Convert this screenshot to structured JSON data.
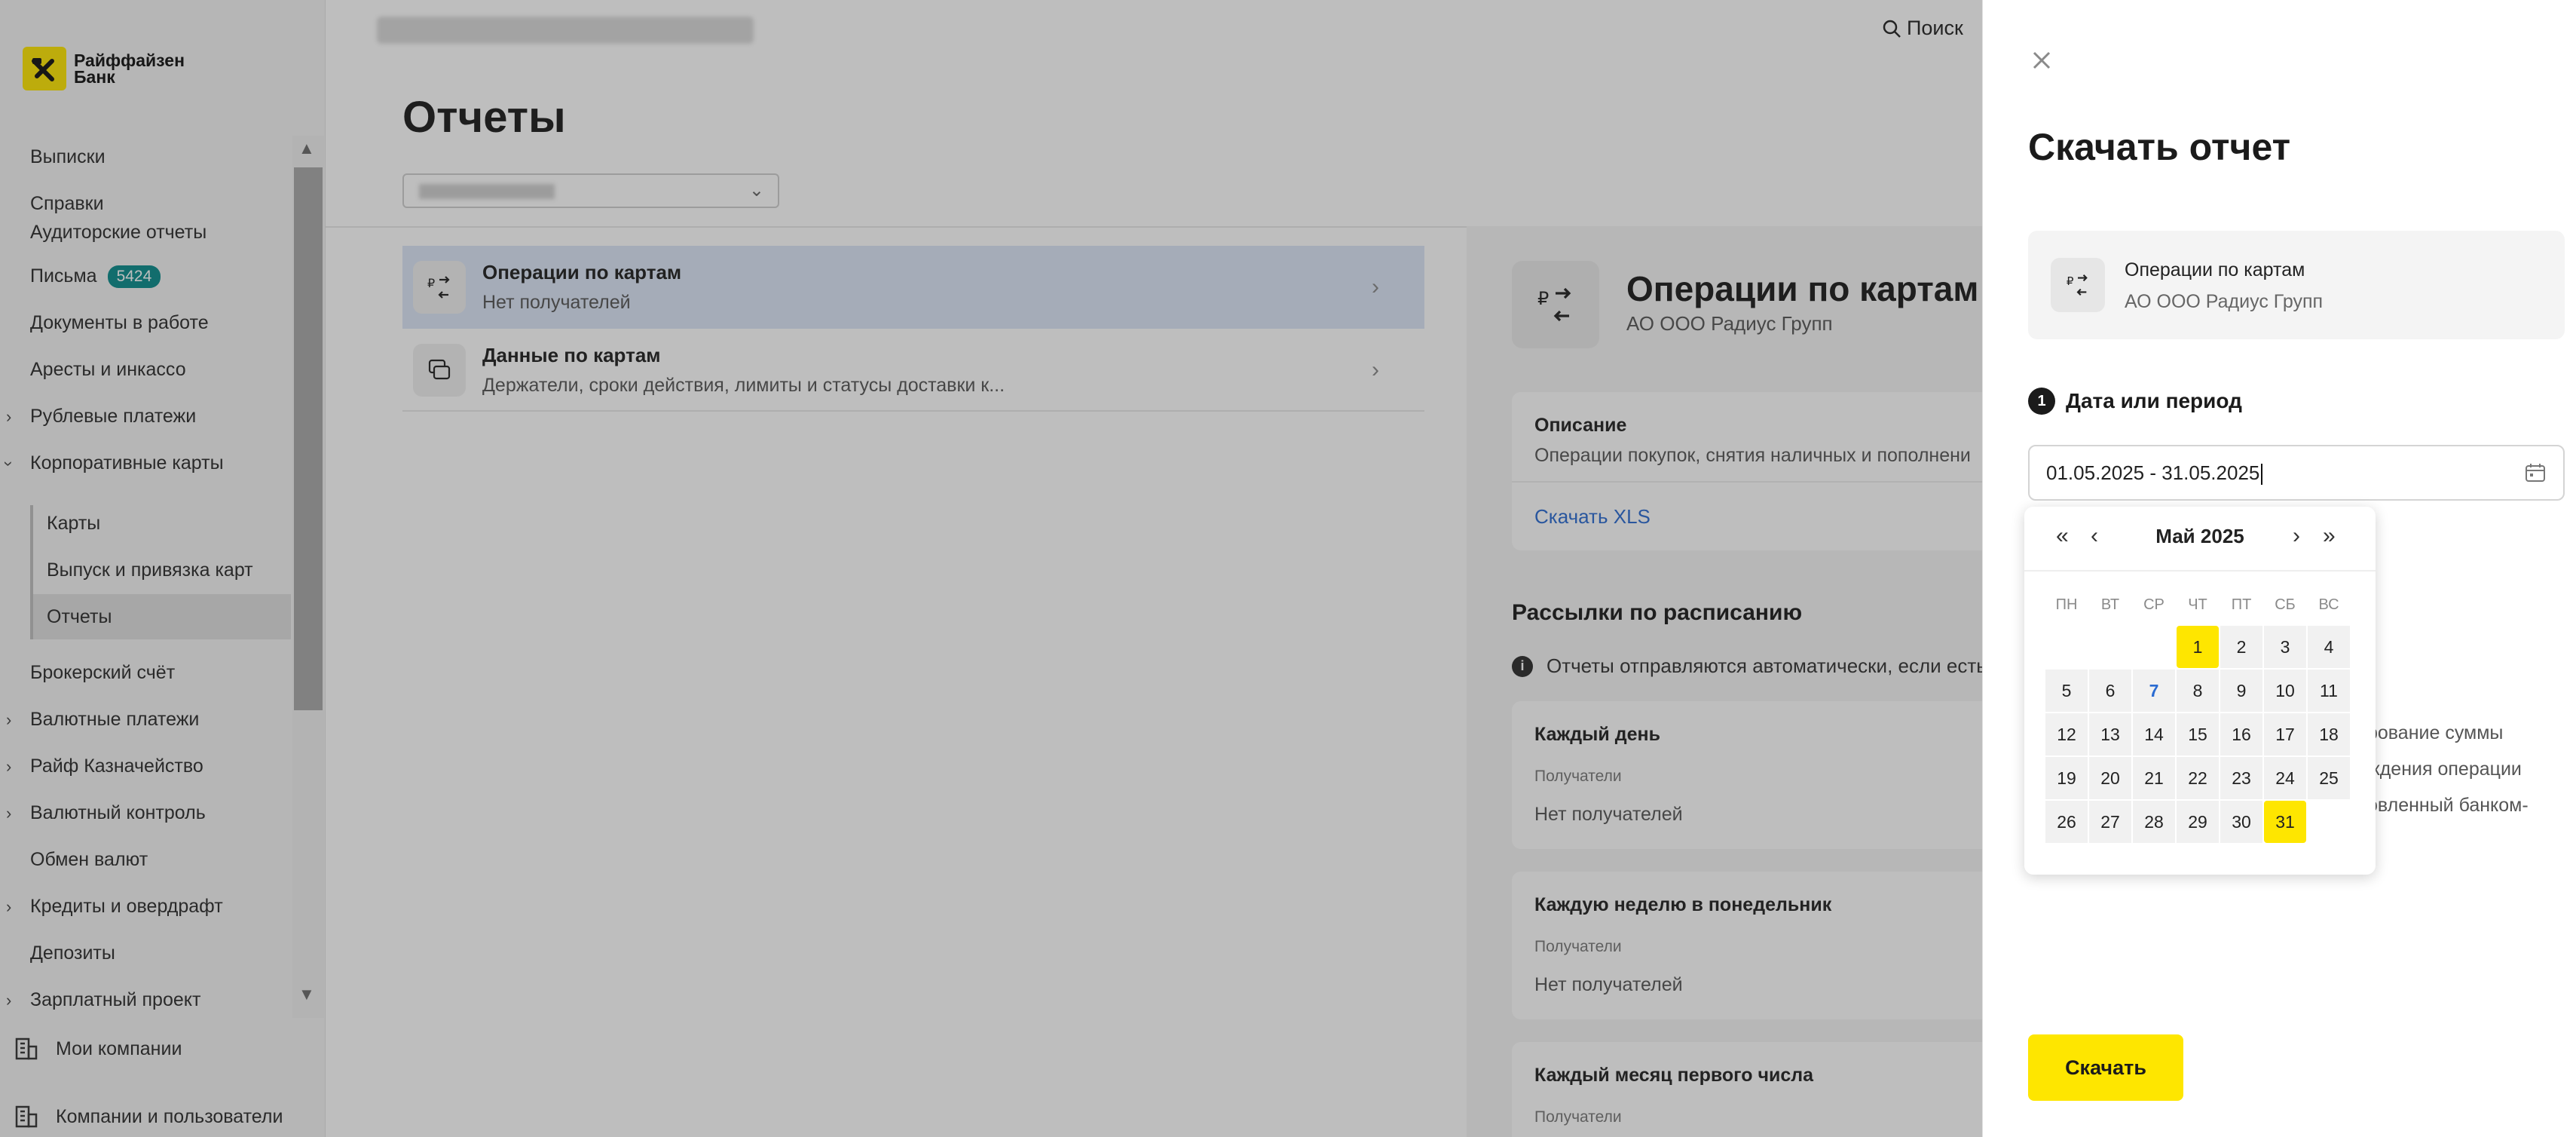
{
  "brand": {
    "name_line1": "Райффайзен",
    "name_line2": "Банк",
    "accent": "#fee600"
  },
  "sidebar": {
    "items": [
      {
        "label": "Выписки"
      },
      {
        "label": "Справки"
      },
      {
        "label": "Аудиторские отчеты"
      },
      {
        "label": "Письма",
        "badge": "5424"
      },
      {
        "label": "Документы в работе"
      },
      {
        "label": "Аресты и инкассо"
      },
      {
        "label": "Рублевые платежи",
        "expandable": true
      },
      {
        "label": "Корпоративные карты",
        "expanded": true
      },
      {
        "label": "Карты",
        "sub": true
      },
      {
        "label": "Выпуск и привязка карт",
        "sub": true
      },
      {
        "label": "Отчеты",
        "sub": true,
        "active": true
      },
      {
        "label": "Брокерский счёт"
      },
      {
        "label": "Валютные платежи",
        "expandable": true
      },
      {
        "label": "Райф Казначейство",
        "expandable": true
      },
      {
        "label": "Валютный контроль",
        "expandable": true
      },
      {
        "label": "Обмен валют"
      },
      {
        "label": "Кредиты и овердрафт",
        "expandable": true
      },
      {
        "label": "Депозиты"
      },
      {
        "label": "Зарплатный проект",
        "expandable": true
      }
    ],
    "bottom": [
      {
        "label": "Мои компании",
        "icon": "building-icon"
      },
      {
        "label": "Компании и пользователи",
        "icon": "building-icon"
      }
    ]
  },
  "header": {
    "search_label": "Поиск"
  },
  "main": {
    "title": "Отчеты",
    "reports": [
      {
        "title": "Операции по картам",
        "subtitle": "Нет получателей",
        "icon": "card-exchange-icon",
        "selected": true
      },
      {
        "title": "Данные по картам",
        "subtitle": "Держатели, сроки действия, лимиты и статусы доставки к...",
        "icon": "cards-stack-icon"
      }
    ]
  },
  "detail": {
    "title": "Операции по картам",
    "company": "АО ООО Радиус Групп",
    "description_label": "Описание",
    "description_text": "Операции покупок, снятия наличных и пополнени",
    "download_xls": "Скачать XLS",
    "schedules_title": "Рассылки по расписанию",
    "schedules_info": "Отчеты отправляются автоматически, если есть",
    "schedules": [
      {
        "label": "Каждый день",
        "recipients_label": "Получатели",
        "recipients": "Нет получателей"
      },
      {
        "label": "Каждую неделю в понедельник",
        "recipients_label": "Получатели",
        "recipients": "Нет получателей"
      },
      {
        "label": "Каждый месяц первого числа",
        "recipients_label": "Получатели",
        "recipients": ""
      }
    ]
  },
  "drawer": {
    "title": "Скачать отчет",
    "report_title": "Операции по картам",
    "report_company": "АО ООО Радиус Групп",
    "step_number": "1",
    "step_label": "Дата или период",
    "date_value": "01.05.2025 - 31.05.2025",
    "hidden_fragments": [
      "рование суммы",
      "ждения операции",
      "овленный банком-"
    ],
    "download_button": "Скачать"
  },
  "calendar": {
    "month_label": "Май 2025",
    "weekdays": [
      "ПН",
      "ВТ",
      "СР",
      "ЧТ",
      "ПТ",
      "СБ",
      "ВС"
    ],
    "first_weekday_index": 3,
    "days_in_month": 31,
    "range_start": 1,
    "range_end": 31,
    "today": 7
  }
}
